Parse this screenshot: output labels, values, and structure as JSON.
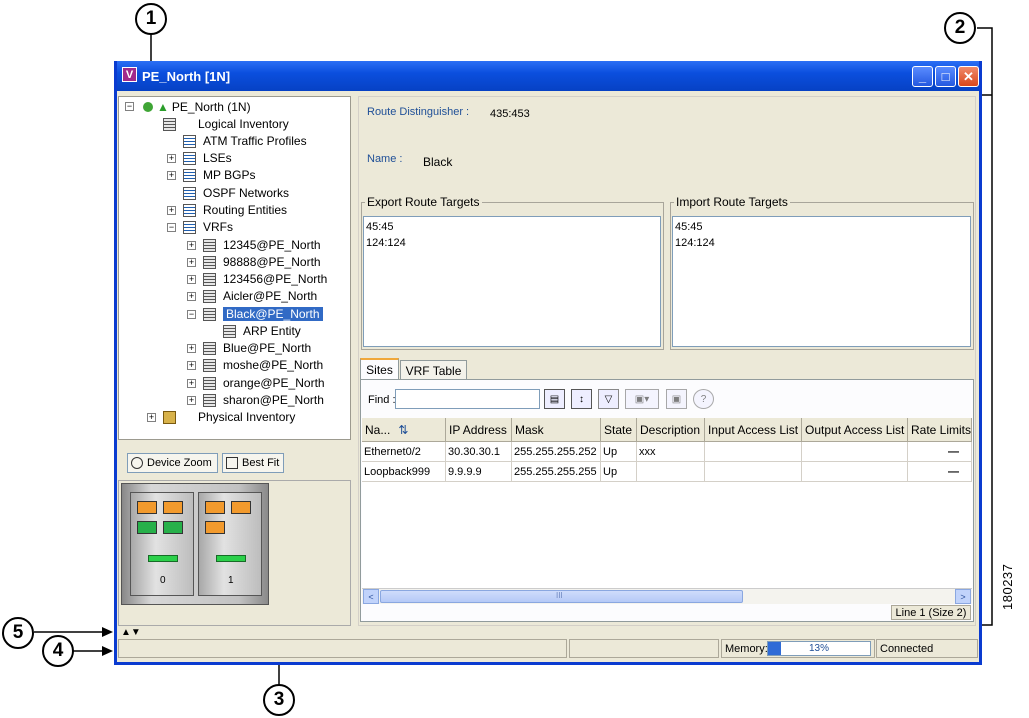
{
  "callouts": [
    "1",
    "2",
    "3",
    "4",
    "5"
  ],
  "figure_number": "180237",
  "window": {
    "title": "PE_North [1N]",
    "icon_letter": "V",
    "minimize": "_",
    "maximize": "□",
    "close": "✕"
  },
  "tree": {
    "root": "PE_North (1N)",
    "logical": "Logical Inventory",
    "items": [
      "ATM Traffic Profiles",
      "LSEs",
      "MP BGPs",
      "OSPF Networks",
      "Routing Entities",
      "VRFs"
    ],
    "vrfs": [
      "12345@PE_North",
      "98888@PE_North",
      "123456@PE_North",
      "Aicler@PE_North",
      "Black@PE_North"
    ],
    "arp": "ARP Entity",
    "vrfs2": [
      "Blue@PE_North",
      "moshe@PE_North",
      "orange@PE_North",
      "sharon@PE_North"
    ],
    "physical": "Physical Inventory",
    "expand": "+",
    "collapse": "−"
  },
  "device": {
    "zoom_button": "Device Zoom",
    "fit_button": "Best Fit",
    "slots": [
      "0",
      "1"
    ]
  },
  "details": {
    "rd_label": "Route Distinguisher :",
    "rd_value": "435:453",
    "name_label": "Name :",
    "name_value": "Black",
    "export_title": "Export Route Targets",
    "export_items": [
      "45:45",
      "124:124"
    ],
    "import_title": "Import Route Targets",
    "import_items": [
      "45:45",
      "124:124"
    ]
  },
  "tabs": [
    "Sites",
    "VRF Table"
  ],
  "find_label": "Find :",
  "table": {
    "headers": [
      "Na...",
      "IP Address",
      "Mask",
      "State",
      "Description",
      "Input Access List",
      "Output Access List",
      "Rate Limits"
    ],
    "rows": [
      [
        "Ethernet0/2",
        "30.30.30.1",
        "255.255.255.252",
        "Up",
        "xxx",
        "",
        "",
        "—"
      ],
      [
        "Loopback999",
        "9.9.9.9",
        "255.255.255.255",
        "Up",
        "",
        "",
        "",
        "—"
      ]
    ]
  },
  "scroll": {
    "left": "<",
    "right": ">",
    "grip": "III"
  },
  "line_info": "Line 1 (Size 2)",
  "status": {
    "memory_label": "Memory:",
    "memory_text": "13%",
    "memory_fraction": 0.13,
    "connection": "Connected"
  },
  "colors": {
    "titlebar": "#0b4fde",
    "selection": "#316ac5",
    "tab_accent": "#f0a83a"
  }
}
